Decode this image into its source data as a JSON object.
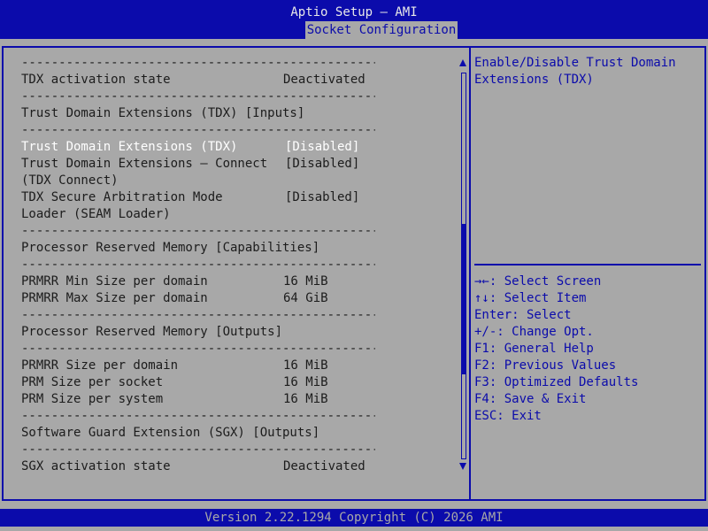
{
  "app": {
    "title": "Aptio Setup – AMI",
    "tab": "Socket Configuration"
  },
  "separator": "----------------------------------------------------------------",
  "rows": {
    "tdx_activation_label": "TDX activation state",
    "tdx_activation_value": "Deactivated",
    "tdx_inputs_header": "Trust Domain Extensions (TDX) [Inputs]",
    "tdx_label": "Trust Domain Extensions (TDX)",
    "tdx_value": "[Disabled]",
    "tdx_connect_label_1": "Trust Domain Extensions – Connect",
    "tdx_connect_label_2": "(TDX Connect)",
    "tdx_connect_value": "[Disabled]",
    "seam_label_1": "TDX Secure Arbitration Mode",
    "seam_label_2": "Loader (SEAM Loader)",
    "seam_value": "[Disabled]",
    "prm_capabilities_header": "Processor Reserved Memory [Capabilities]",
    "prmrr_min_label": "PRMRR Min Size per domain",
    "prmrr_min_value": "16 MiB",
    "prmrr_max_label": "PRMRR Max Size per domain",
    "prmrr_max_value": "64 GiB",
    "prm_outputs_header": "Processor Reserved Memory [Outputs]",
    "prmrr_size_label": "PRMRR Size per domain",
    "prmrr_size_value": "16 MiB",
    "prm_socket_label": "PRM Size per socket",
    "prm_socket_value": "16 MiB",
    "prm_system_label": "PRM Size per system",
    "prm_system_value": "16 MiB",
    "sgx_outputs_header": "Software Guard Extension (SGX) [Outputs]",
    "sgx_activation_label": "SGX activation state",
    "sgx_activation_value": "Deactivated"
  },
  "help": {
    "line1": "Enable/Disable Trust Domain",
    "line2": "Extensions (TDX)"
  },
  "keys": {
    "select_screen": "→←: Select Screen",
    "select_item": "↑↓: Select Item",
    "enter": "Enter: Select",
    "change": "+/-: Change Opt.",
    "f1": "F1: General Help",
    "f2": "F2: Previous Values",
    "f3": "F3: Optimized Defaults",
    "f4": "F4: Save & Exit",
    "esc": "ESC: Exit"
  },
  "footer": "Version 2.22.1294 Copyright (C) 2026 AMI",
  "scroll": {
    "position_fraction": 0.39,
    "visible_fraction": 0.39
  },
  "colors": {
    "primary": "#0b0bab",
    "background": "#a8a8a8",
    "highlight_text": "#ffffff"
  }
}
